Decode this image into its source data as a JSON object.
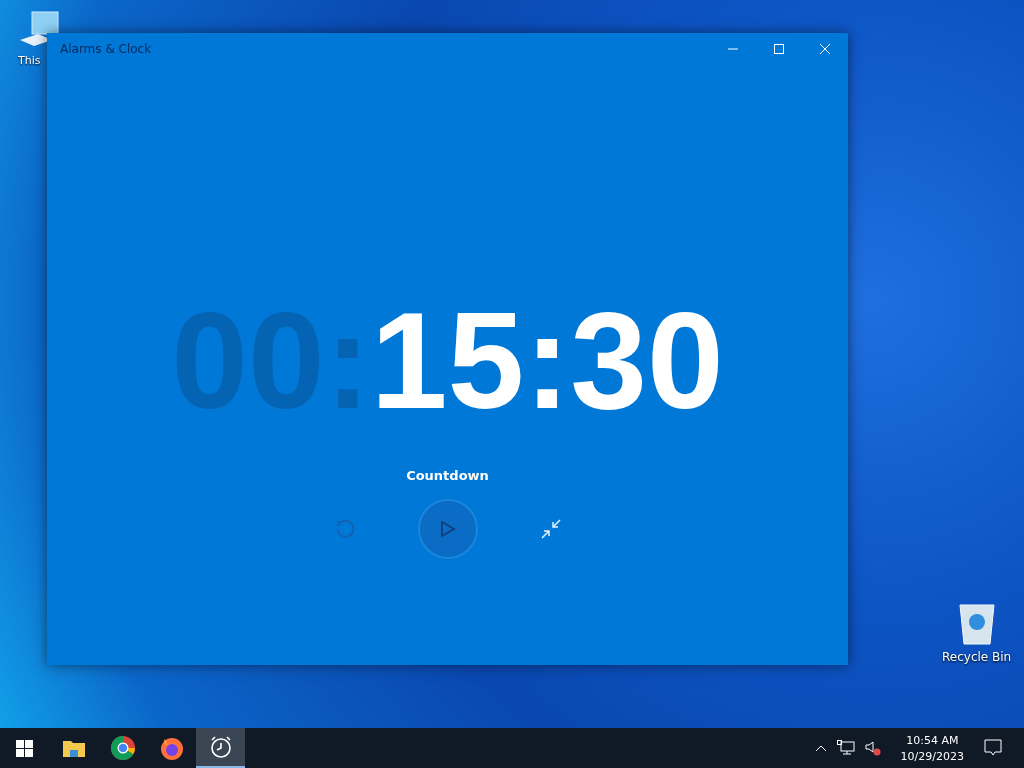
{
  "desktop_icons": [
    {
      "kind": "computer",
      "label": "This"
    },
    {
      "kind": "recycle",
      "label": "Recycle Bin"
    }
  ],
  "window": {
    "title": "Alarms & Clock"
  },
  "timer": [
    {
      "text": "00:",
      "dim": true
    },
    {
      "text": "15:30",
      "dim": false
    }
  ],
  "timer_name": "Countdown",
  "play_button": {
    "disabled": true
  },
  "taskbar": {
    "apps": [
      {
        "kind": "start",
        "active": false
      },
      {
        "kind": "folder",
        "active": false
      },
      {
        "kind": "chrome",
        "active": false
      },
      {
        "kind": "firefox",
        "active": false
      },
      {
        "kind": "clock",
        "active": true
      }
    ],
    "time": "10:54 AM",
    "date": "10/29/2023"
  }
}
